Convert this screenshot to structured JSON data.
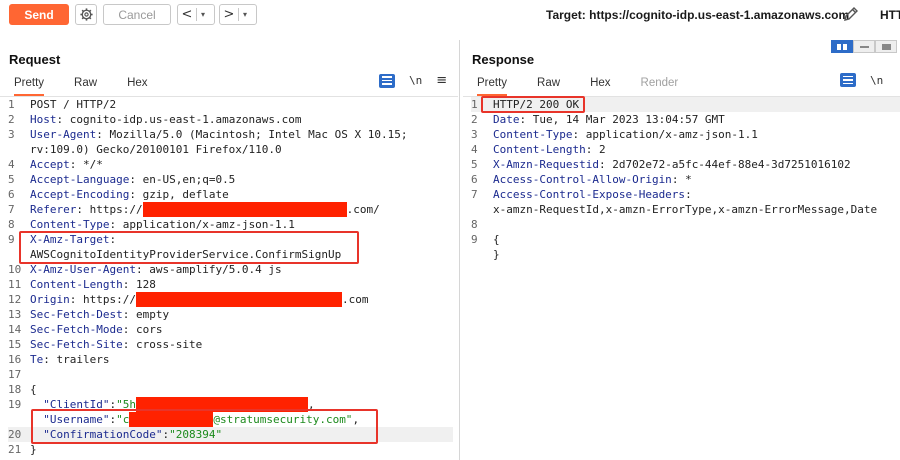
{
  "toolbar": {
    "send_label": "Send",
    "cancel_label": "Cancel",
    "back_arrow": "<",
    "forward_arrow": ">",
    "dropdown_glyph": "▾",
    "target_text": "Target: https://cognito-idp.us-east-1.amazonaws.com",
    "protocol_cut": "HTTP",
    "accent_color": "#ff6633"
  },
  "request": {
    "title": "Request",
    "tabs": [
      {
        "label": "Pretty",
        "active": true
      },
      {
        "label": "Raw",
        "active": false
      },
      {
        "label": "Hex",
        "active": false
      }
    ],
    "newline_toggle": "\\n",
    "lines": [
      {
        "n": "1",
        "key": "",
        "sep": "",
        "val": "POST / HTTP/2"
      },
      {
        "n": "2",
        "key": "Host",
        "sep": ": ",
        "val": "cognito-idp.us-east-1.amazonaws.com"
      },
      {
        "n": "3",
        "key": "User-Agent",
        "sep": ": ",
        "val": "Mozilla/5.0 (Macintosh; Intel Mac OS X 10.15;"
      },
      {
        "n": "",
        "key": "",
        "sep": "",
        "val": "rv:109.0) Gecko/20100101 Firefox/110.0"
      },
      {
        "n": "4",
        "key": "Accept",
        "sep": ": ",
        "val": "*/*"
      },
      {
        "n": "5",
        "key": "Accept-Language",
        "sep": ": ",
        "val": "en-US,en;q=0.5"
      },
      {
        "n": "6",
        "key": "Accept-Encoding",
        "sep": ": ",
        "val": "gzip, deflate"
      },
      {
        "n": "7",
        "key": "Referer",
        "sep": ": ",
        "val": "https://",
        "tail": ".com/"
      },
      {
        "n": "8",
        "key": "Content-Type",
        "sep": ": ",
        "val": "application/x-amz-json-1.1"
      },
      {
        "n": "9",
        "key": "X-Amz-Target",
        "sep": ":",
        "val": ""
      },
      {
        "n": "",
        "key": "",
        "sep": "",
        "val": "AWSCognitoIdentityProviderService.ConfirmSignUp"
      },
      {
        "n": "10",
        "key": "X-Amz-User-Agent",
        "sep": ": ",
        "val": "aws-amplify/5.0.4 js"
      },
      {
        "n": "11",
        "key": "Content-Length",
        "sep": ": ",
        "val": "128"
      },
      {
        "n": "12",
        "key": "Origin",
        "sep": ": ",
        "val": "https://",
        "tail": ".com"
      },
      {
        "n": "13",
        "key": "Sec-Fetch-Dest",
        "sep": ": ",
        "val": "empty"
      },
      {
        "n": "14",
        "key": "Sec-Fetch-Mode",
        "sep": ": ",
        "val": "cors"
      },
      {
        "n": "15",
        "key": "Sec-Fetch-Site",
        "sep": ": ",
        "val": "cross-site"
      },
      {
        "n": "16",
        "key": "Te",
        "sep": ": ",
        "val": "trailers"
      },
      {
        "n": "17",
        "key": "",
        "sep": "",
        "val": ""
      },
      {
        "n": "18",
        "key": "",
        "sep": "",
        "val": "{"
      }
    ],
    "body": {
      "clientid_key": "\"ClientId\"",
      "clientid_val": "\"5h",
      "clientid_tail": ",",
      "username_key": "\"Username\"",
      "username_val": "\"c",
      "username_tail": "@stratumsecurity.com\"",
      "username_comma": ",",
      "code_key": "\"ConfirmationCode\"",
      "code_val": "\"208394\"",
      "close": "}",
      "line19": "19",
      "line20": "20",
      "line21": "21"
    }
  },
  "response": {
    "title": "Response",
    "tabs": [
      {
        "label": "Pretty",
        "active": true
      },
      {
        "label": "Raw",
        "active": false
      },
      {
        "label": "Hex",
        "active": false
      },
      {
        "label": "Render",
        "active": false,
        "disabled": true
      }
    ],
    "newline_toggle": "\\n",
    "lines": [
      {
        "n": "1",
        "key": "",
        "sep": "",
        "val": "HTTP/2 200 OK"
      },
      {
        "n": "2",
        "key": "Date",
        "sep": ": ",
        "val": "Tue, 14 Mar 2023 13:04:57 GMT"
      },
      {
        "n": "3",
        "key": "Content-Type",
        "sep": ": ",
        "val": "application/x-amz-json-1.1"
      },
      {
        "n": "4",
        "key": "Content-Length",
        "sep": ": ",
        "val": "2"
      },
      {
        "n": "5",
        "key": "X-Amzn-Requestid",
        "sep": ": ",
        "val": "2d702e72-a5fc-44ef-88e4-3d7251016102"
      },
      {
        "n": "6",
        "key": "Access-Control-Allow-Origin",
        "sep": ": ",
        "val": "*"
      },
      {
        "n": "7",
        "key": "Access-Control-Expose-Headers",
        "sep": ":",
        "val": ""
      },
      {
        "n": "",
        "key": "",
        "sep": "",
        "val": "x-amzn-RequestId,x-amzn-ErrorType,x-amzn-ErrorMessage,Date"
      },
      {
        "n": "8",
        "key": "",
        "sep": "",
        "val": ""
      },
      {
        "n": "9",
        "key": "",
        "sep": "",
        "val": "{"
      },
      {
        "n": "",
        "key": "",
        "sep": "",
        "val": "}"
      }
    ]
  }
}
